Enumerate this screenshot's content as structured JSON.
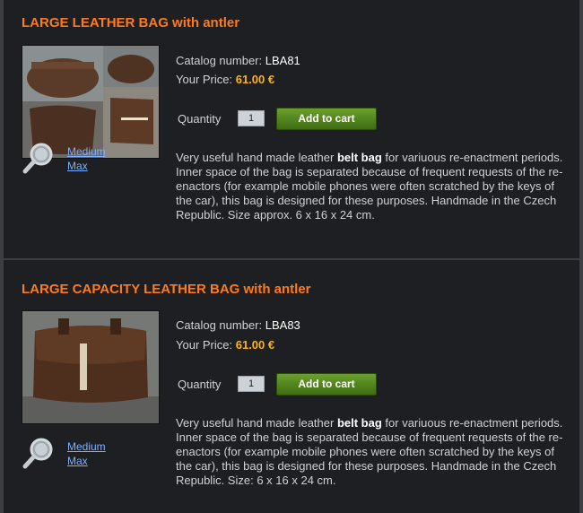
{
  "products": [
    {
      "title": "LARGE LEATHER BAG with antler",
      "catalog_label": "Catalog number:",
      "catalog_number": "LBA81",
      "price_label": "Your Price:",
      "price": "61.00 €",
      "quantity_label": "Quantity",
      "quantity_value": "1",
      "add_to_cart_label": "Add to cart",
      "image_sizes": [
        "Medium",
        "Max"
      ],
      "description_prefix": "Very useful hand made leather ",
      "description_bold": "belt bag",
      "description_suffix": " for variuous re-enactment periods. Inner space of the bag is separated because of frequent requests of the re-enactors (for example mobile phones were often scratched by the keys of the car), this bag is designed for these purposes. Handmade in the Czech Republic. Size approx. 6 x 16 x 24 cm."
    },
    {
      "title": "LARGE CAPACITY LEATHER BAG with antler",
      "catalog_label": "Catalog number:",
      "catalog_number": "LBA83",
      "price_label": "Your Price:",
      "price": "61.00 €",
      "quantity_label": "Quantity",
      "quantity_value": "1",
      "add_to_cart_label": "Add to cart",
      "image_sizes": [
        "Medium",
        "Max"
      ],
      "description_prefix": "Very useful hand made leather ",
      "description_bold": "belt bag",
      "description_suffix": " for variuous re-enactment periods. Inner space of the bag is separated because of frequent requests of the re-enactors (for example mobile phones were often scratched by the keys of the car), this bag is designed for these purposes. Handmade in the Czech Republic. Size: 6 x  16 x 24 cm."
    }
  ],
  "colors": {
    "background": "#1d1f22",
    "title": "#ff7a1a",
    "price": "#ffb21a",
    "link": "#7fb0ff",
    "button": "#4f8a1c"
  },
  "icons": [
    "magnifier-icon"
  ]
}
